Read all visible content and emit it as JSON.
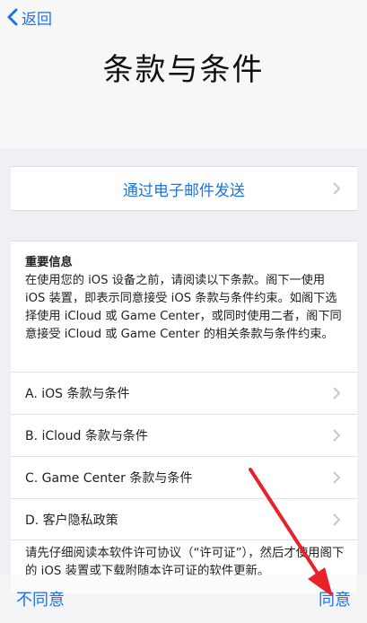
{
  "nav": {
    "back_label": "返回"
  },
  "title": "条款与条件",
  "email": {
    "label": "通过电子邮件发送"
  },
  "info": {
    "heading": "重要信息",
    "body": "在使用您的 iOS 设备之前，请阅读以下条款。阁下一使用 iOS 装置，即表示同意接受 iOS 条款与条件约束。如阁下选择使用 iCloud 或 Game Center，或同时使用二者，阁下同意接受 iCloud 或 Game Center 的相关条款与条件约束。"
  },
  "items": [
    {
      "label": "A. iOS 条款与条件"
    },
    {
      "label": "B. iCloud 条款与条件"
    },
    {
      "label": "C. Game Center 条款与条件"
    },
    {
      "label": "D. 客户隐私政策"
    }
  ],
  "license_text": "请先仔细阅读本软件许可协议（“许可证”），然后才使用阁下的 iOS 装置或下载附随本许可证的软件更新。",
  "bottom": {
    "disagree": "不同意",
    "agree": "同意"
  },
  "colors": {
    "accent": "#1a73e8",
    "arrow": "#e8212a"
  }
}
